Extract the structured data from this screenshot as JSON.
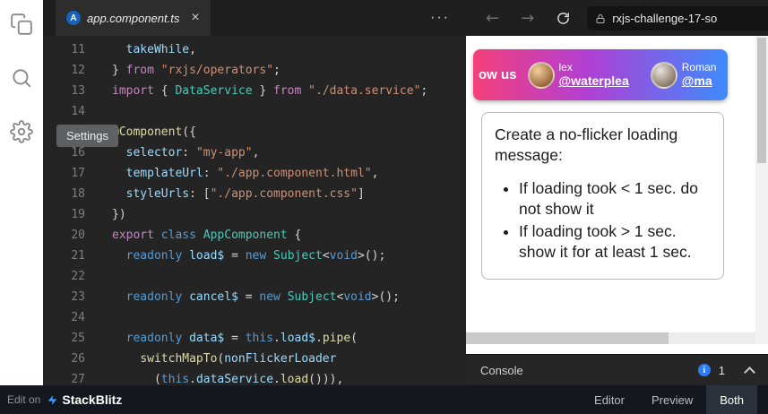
{
  "activity_bar": {
    "tooltip": "Settings",
    "icons": [
      "files",
      "search",
      "settings"
    ]
  },
  "tab_bar": {
    "tab": {
      "label": "app.component.ts",
      "close": "×",
      "icon_letter": "A"
    },
    "more": "···"
  },
  "preview_nav": {
    "back_glyph": "←",
    "forward_glyph": "→",
    "url": "rxjs-challenge-17-so"
  },
  "editor": {
    "token_colors": {
      "plain": "#d4d4d4",
      "kw1": "#c586c0",
      "kw2": "#569cd6",
      "str": "#ce9178",
      "type": "#4ec9b8",
      "prop": "#9cdcfe",
      "fn": "#dcdcaa"
    },
    "lines": [
      {
        "num": 11,
        "tokens": [
          {
            "t": "  ",
            "c": "plain"
          },
          {
            "t": "takeWhile",
            "c": "prop"
          },
          {
            "t": ",",
            "c": "plain"
          }
        ]
      },
      {
        "num": 12,
        "tokens": [
          {
            "t": "} ",
            "c": "plain"
          },
          {
            "t": "from",
            "c": "kw1"
          },
          {
            "t": " ",
            "c": "plain"
          },
          {
            "t": "\"rxjs/operators\"",
            "c": "str"
          },
          {
            "t": ";",
            "c": "plain"
          }
        ]
      },
      {
        "num": 13,
        "tokens": [
          {
            "t": "import",
            "c": "kw1"
          },
          {
            "t": " { ",
            "c": "plain"
          },
          {
            "t": "DataService",
            "c": "type"
          },
          {
            "t": " } ",
            "c": "plain"
          },
          {
            "t": "from",
            "c": "kw1"
          },
          {
            "t": " ",
            "c": "plain"
          },
          {
            "t": "\"./data.service\"",
            "c": "str"
          },
          {
            "t": ";",
            "c": "plain"
          }
        ]
      },
      {
        "num": 14,
        "tokens": []
      },
      {
        "num": 15,
        "tokens": [
          {
            "t": "@Component",
            "c": "fn"
          },
          {
            "t": "({",
            "c": "plain"
          }
        ]
      },
      {
        "num": 16,
        "tokens": [
          {
            "t": "  ",
            "c": "plain"
          },
          {
            "t": "selector",
            "c": "prop"
          },
          {
            "t": ": ",
            "c": "plain"
          },
          {
            "t": "\"my-app\"",
            "c": "str"
          },
          {
            "t": ",",
            "c": "plain"
          }
        ]
      },
      {
        "num": 17,
        "tokens": [
          {
            "t": "  ",
            "c": "plain"
          },
          {
            "t": "templateUrl",
            "c": "prop"
          },
          {
            "t": ": ",
            "c": "plain"
          },
          {
            "t": "\"./app.component.html\"",
            "c": "str"
          },
          {
            "t": ",",
            "c": "plain"
          }
        ]
      },
      {
        "num": 18,
        "tokens": [
          {
            "t": "  ",
            "c": "plain"
          },
          {
            "t": "styleUrls",
            "c": "prop"
          },
          {
            "t": ": [",
            "c": "plain"
          },
          {
            "t": "\"./app.component.css\"",
            "c": "str"
          },
          {
            "t": "]",
            "c": "plain"
          }
        ]
      },
      {
        "num": 19,
        "tokens": [
          {
            "t": "})",
            "c": "plain"
          }
        ]
      },
      {
        "num": 20,
        "tokens": [
          {
            "t": "export",
            "c": "kw1"
          },
          {
            "t": " ",
            "c": "plain"
          },
          {
            "t": "class",
            "c": "kw2"
          },
          {
            "t": " ",
            "c": "plain"
          },
          {
            "t": "AppComponent",
            "c": "type"
          },
          {
            "t": " {",
            "c": "plain"
          }
        ]
      },
      {
        "num": 21,
        "tokens": [
          {
            "t": "  ",
            "c": "plain"
          },
          {
            "t": "readonly",
            "c": "kw2"
          },
          {
            "t": " ",
            "c": "plain"
          },
          {
            "t": "load$",
            "c": "prop"
          },
          {
            "t": " = ",
            "c": "plain"
          },
          {
            "t": "new",
            "c": "kw2"
          },
          {
            "t": " ",
            "c": "plain"
          },
          {
            "t": "Subject",
            "c": "type"
          },
          {
            "t": "<",
            "c": "plain"
          },
          {
            "t": "void",
            "c": "kw2"
          },
          {
            "t": ">();",
            "c": "plain"
          }
        ]
      },
      {
        "num": 22,
        "tokens": []
      },
      {
        "num": 23,
        "tokens": [
          {
            "t": "  ",
            "c": "plain"
          },
          {
            "t": "readonly",
            "c": "kw2"
          },
          {
            "t": " ",
            "c": "plain"
          },
          {
            "t": "cancel$",
            "c": "prop"
          },
          {
            "t": " = ",
            "c": "plain"
          },
          {
            "t": "new",
            "c": "kw2"
          },
          {
            "t": " ",
            "c": "plain"
          },
          {
            "t": "Subject",
            "c": "type"
          },
          {
            "t": "<",
            "c": "plain"
          },
          {
            "t": "void",
            "c": "kw2"
          },
          {
            "t": ">();",
            "c": "plain"
          }
        ]
      },
      {
        "num": 24,
        "tokens": []
      },
      {
        "num": 25,
        "tokens": [
          {
            "t": "  ",
            "c": "plain"
          },
          {
            "t": "readonly",
            "c": "kw2"
          },
          {
            "t": " ",
            "c": "plain"
          },
          {
            "t": "data$",
            "c": "prop"
          },
          {
            "t": " = ",
            "c": "plain"
          },
          {
            "t": "this",
            "c": "kw2"
          },
          {
            "t": ".",
            "c": "plain"
          },
          {
            "t": "load$",
            "c": "prop"
          },
          {
            "t": ".",
            "c": "plain"
          },
          {
            "t": "pipe",
            "c": "fn"
          },
          {
            "t": "(",
            "c": "plain"
          }
        ]
      },
      {
        "num": 26,
        "tokens": [
          {
            "t": "    ",
            "c": "plain"
          },
          {
            "t": "switchMapTo",
            "c": "fn"
          },
          {
            "t": "(",
            "c": "plain"
          },
          {
            "t": "nonFlickerLoader",
            "c": "prop"
          }
        ]
      },
      {
        "num": 27,
        "tokens": [
          {
            "t": "      (",
            "c": "plain"
          },
          {
            "t": "this",
            "c": "kw2"
          },
          {
            "t": ".",
            "c": "plain"
          },
          {
            "t": "dataService",
            "c": "prop"
          },
          {
            "t": ".",
            "c": "plain"
          },
          {
            "t": "load",
            "c": "fn"
          },
          {
            "t": "())),",
            "c": "plain"
          }
        ]
      }
    ]
  },
  "preview": {
    "banner": {
      "follow_text": "ow us",
      "people": [
        {
          "name": "lex",
          "handle": "@waterplea"
        },
        {
          "name": "Roman",
          "handle": "@ma"
        }
      ]
    },
    "card": {
      "title": "Create a no-flicker loading message:",
      "bullets": [
        "If loading took < 1 sec. do not show it",
        "If loading took > 1 sec. show it for at least 1 sec."
      ]
    }
  },
  "console": {
    "label": "Console",
    "badge_count": "1"
  },
  "status_bar": {
    "edit_on": "Edit on",
    "brand": "StackBlitz",
    "modes": [
      "Editor",
      "Preview",
      "Both"
    ],
    "active_mode": "Both"
  },
  "colors": {
    "banner_gradient": [
      "#f43f7b",
      "#b13fd4",
      "#3d8bfd"
    ],
    "console_badge": "#2f7df6",
    "stackblitz_bolt": "#3f9bfa",
    "file_icon_blue": "#1565c0"
  }
}
